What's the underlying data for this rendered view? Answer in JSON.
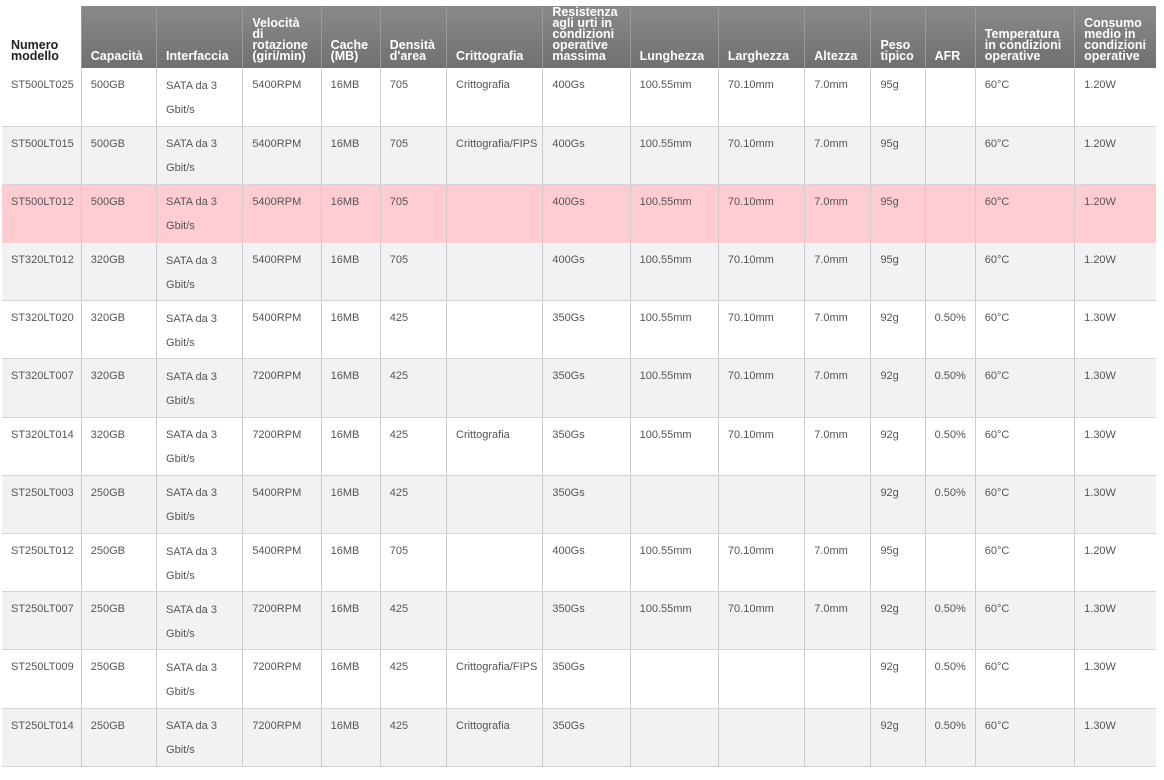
{
  "headers": [
    "Numero modello",
    "Capacità",
    "Interfaccia",
    "Velocità di rotazione (giri/min)",
    "Cache (MB)",
    "Densità d'area",
    "Crittografia",
    "Resistenza agli urti in condizioni operative massima",
    "Lunghezza",
    "Larghezza",
    "Altezza",
    "Peso tipico",
    "AFR",
    "Temperatura in condizioni operative",
    "Consumo medio in condizioni operative"
  ],
  "highlight_color": "#ffccd2",
  "header_color": "#7a7a7a",
  "rows": [
    [
      "ST500LT025",
      "500GB",
      "SATA da 3 Gbit/s",
      "5400RPM",
      "16MB",
      "705",
      "Crittografia",
      "400Gs",
      "100.55mm",
      "70.10mm",
      "7.0mm",
      "95g",
      "",
      "60°C",
      "1.20W"
    ],
    [
      "ST500LT015",
      "500GB",
      "SATA da 3 Gbit/s",
      "5400RPM",
      "16MB",
      "705",
      "Crittografia/FIPS",
      "400Gs",
      "100.55mm",
      "70.10mm",
      "7.0mm",
      "95g",
      "",
      "60°C",
      "1.20W"
    ],
    [
      "ST500LT012",
      "500GB",
      "SATA da 3 Gbit/s",
      "5400RPM",
      "16MB",
      "705",
      "",
      "400Gs",
      "100.55mm",
      "70.10mm",
      "7.0mm",
      "95g",
      "",
      "60°C",
      "1.20W"
    ],
    [
      "ST320LT012",
      "320GB",
      "SATA da 3 Gbit/s",
      "5400RPM",
      "16MB",
      "705",
      "",
      "400Gs",
      "100.55mm",
      "70.10mm",
      "7.0mm",
      "95g",
      "",
      "60°C",
      "1.20W"
    ],
    [
      "ST320LT020",
      "320GB",
      "SATA da 3 Gbit/s",
      "5400RPM",
      "16MB",
      "425",
      "",
      "350Gs",
      "100.55mm",
      "70.10mm",
      "7.0mm",
      "92g",
      "0.50%",
      "60°C",
      "1.30W"
    ],
    [
      "ST320LT007",
      "320GB",
      "SATA da 3 Gbit/s",
      "7200RPM",
      "16MB",
      "425",
      "",
      "350Gs",
      "100.55mm",
      "70.10mm",
      "7.0mm",
      "92g",
      "0.50%",
      "60°C",
      "1.30W"
    ],
    [
      "ST320LT014",
      "320GB",
      "SATA da 3 Gbit/s",
      "7200RPM",
      "16MB",
      "425",
      "Crittografia",
      "350Gs",
      "100.55mm",
      "70.10mm",
      "7.0mm",
      "92g",
      "0.50%",
      "60°C",
      "1.30W"
    ],
    [
      "ST250LT003",
      "250GB",
      "SATA da 3 Gbit/s",
      "5400RPM",
      "16MB",
      "425",
      "",
      "350Gs",
      "",
      "",
      "",
      "92g",
      "0.50%",
      "60°C",
      "1.30W"
    ],
    [
      "ST250LT012",
      "250GB",
      "SATA da 3 Gbit/s",
      "5400RPM",
      "16MB",
      "705",
      "",
      "400Gs",
      "100.55mm",
      "70.10mm",
      "7.0mm",
      "95g",
      "",
      "60°C",
      "1.20W"
    ],
    [
      "ST250LT007",
      "250GB",
      "SATA da 3 Gbit/s",
      "7200RPM",
      "16MB",
      "425",
      "",
      "350Gs",
      "100.55mm",
      "70.10mm",
      "7.0mm",
      "92g",
      "0.50%",
      "60°C",
      "1.30W"
    ],
    [
      "ST250LT009",
      "250GB",
      "SATA da 3 Gbit/s",
      "7200RPM",
      "16MB",
      "425",
      "Crittografia/FIPS",
      "350Gs",
      "",
      "",
      "",
      "92g",
      "0.50%",
      "60°C",
      "1.30W"
    ],
    [
      "ST250LT014",
      "250GB",
      "SATA da 3 Gbit/s",
      "7200RPM",
      "16MB",
      "425",
      "Crittografia",
      "350Gs",
      "",
      "",
      "",
      "92g",
      "0.50%",
      "60°C",
      "1.30W"
    ]
  ],
  "highlighted_row": 2
}
